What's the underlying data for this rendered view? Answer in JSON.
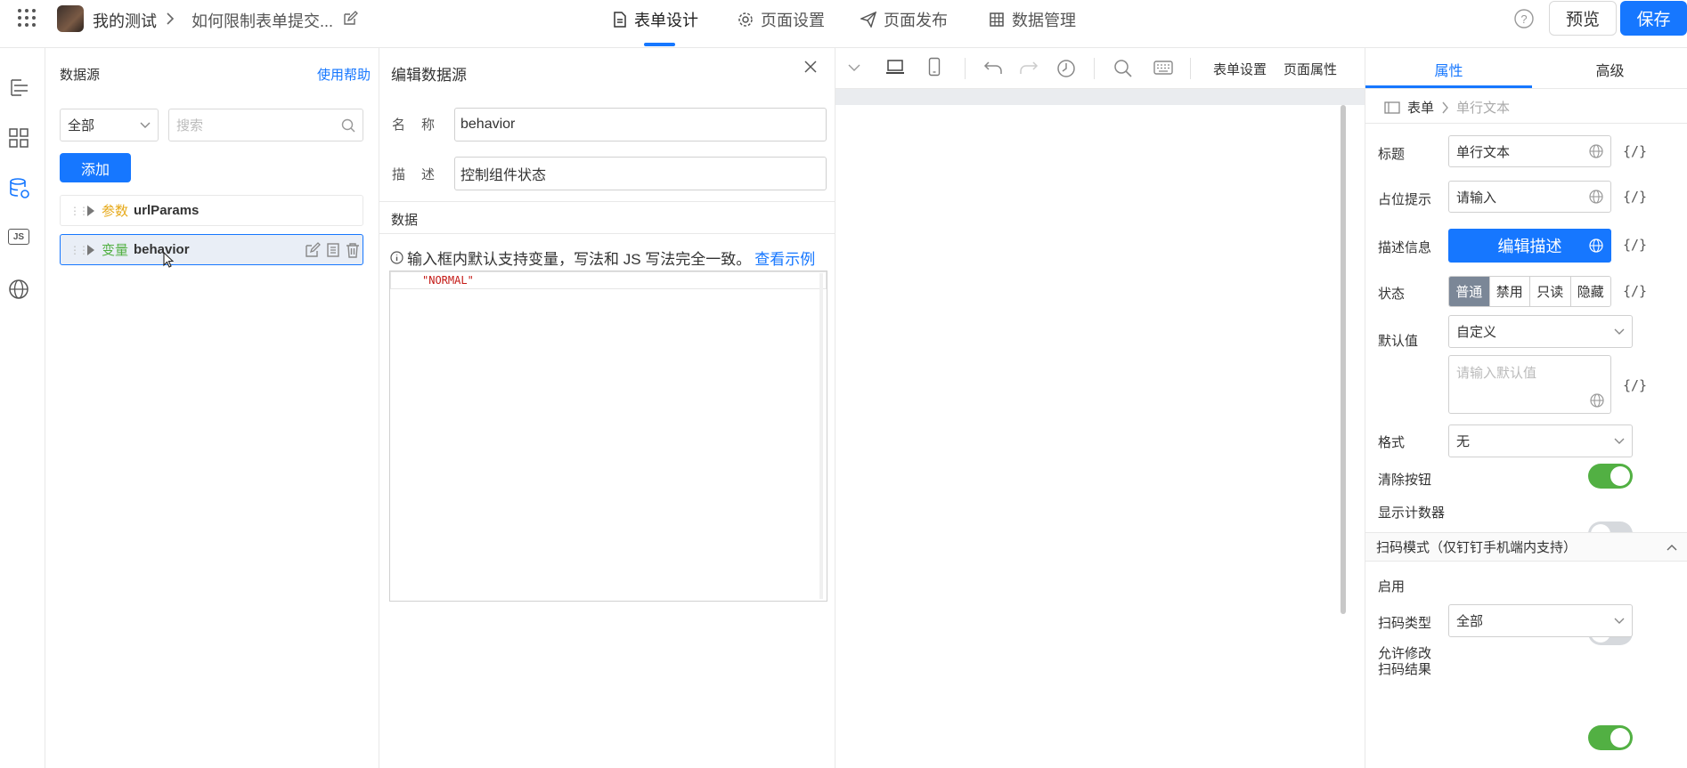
{
  "header": {
    "app_name": "我的测试",
    "page_title": "如何限制表单提交...",
    "tabs": [
      {
        "label": "表单设计",
        "icon": "document-icon"
      },
      {
        "label": "页面设置",
        "icon": "gear-icon"
      },
      {
        "label": "页面发布",
        "icon": "send-icon"
      },
      {
        "label": "数据管理",
        "icon": "table-icon"
      }
    ],
    "preview_label": "预览",
    "save_label": "保存"
  },
  "rail": {
    "items": [
      {
        "icon": "outline-tree-icon"
      },
      {
        "icon": "components-grid-icon"
      },
      {
        "icon": "datasource-icon",
        "active": true
      },
      {
        "icon": "js-icon",
        "text": "JS"
      },
      {
        "icon": "globe-icon"
      }
    ]
  },
  "datasource": {
    "title": "数据源",
    "help_link": "使用帮助",
    "filter_value": "全部",
    "search_placeholder": "搜索",
    "add_label": "添加",
    "items": [
      {
        "tag": "参数",
        "name": "urlParams"
      },
      {
        "tag": "变量",
        "name": "behavior"
      }
    ]
  },
  "edit": {
    "title": "编辑数据源",
    "name_label": "名称",
    "name_value": "behavior",
    "desc_label": "描述",
    "desc_value": "控制组件状态",
    "data_label": "数据",
    "tip_text": "输入框内默认支持变量，写法和 JS 写法完全一致。",
    "tip_link": "查看示例",
    "code": "\"NORMAL\""
  },
  "toolbar": {
    "form_settings": "表单设置",
    "page_props": "页面属性"
  },
  "props": {
    "tabs": [
      "属性",
      "高级"
    ],
    "breadcrumb": [
      "表单",
      "单行文本"
    ],
    "title_label": "标题",
    "title_value": "单行文本",
    "placeholder_label": "占位提示",
    "placeholder_value": "请输入",
    "desc_label": "描述信息",
    "desc_button": "编辑描述",
    "state_label": "状态",
    "state_options": [
      "普通",
      "禁用",
      "只读",
      "隐藏"
    ],
    "default_label": "默认值",
    "default_value": "自定义",
    "default_placeholder": "请输入默认值",
    "format_label": "格式",
    "format_value": "无",
    "clear_label": "清除按钮",
    "clear_on": true,
    "counter_label": "显示计数器",
    "counter_on": false,
    "scan_section": "扫码模式（仅钉钉手机端内支持）",
    "enable_label": "启用",
    "enable_on": false,
    "scan_type_label": "扫码类型",
    "scan_type_value": "全部",
    "allow_edit_label_1": "允许修改",
    "allow_edit_label_2": "扫码结果",
    "allow_edit_on": true,
    "fx": "{/}"
  },
  "colors": {
    "accent": "#1677ff",
    "toggle_on": "#52b043",
    "param_tag": "#e6a817",
    "var_tag": "#52b043"
  }
}
